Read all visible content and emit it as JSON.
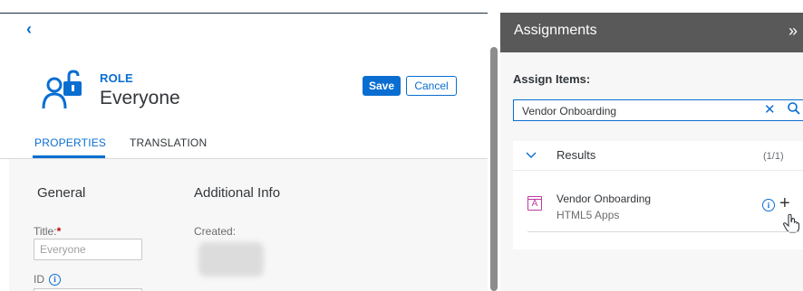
{
  "header": {
    "back_icon": "chevron-left-icon"
  },
  "role": {
    "type_label": "ROLE",
    "name": "Everyone",
    "icon": "user-unlocked-icon",
    "icon_color": "#0a6ed1"
  },
  "actions": {
    "save_label": "Save",
    "cancel_label": "Cancel",
    "accent": "#0a6ed1"
  },
  "tabs": [
    {
      "label": "PROPERTIES",
      "selected": true
    },
    {
      "label": "TRANSLATION",
      "selected": false
    }
  ],
  "general": {
    "title": "General",
    "title_field_label": "Title:",
    "required_mark": "*",
    "title_placeholder": "Everyone",
    "id_label": "ID",
    "id_info_icon": "info-icon"
  },
  "additional_info": {
    "title": "Additional Info",
    "created_label": "Created:"
  },
  "assignments": {
    "panel_title": "Assignments",
    "collapse_icon": "double-chevron-right-icon",
    "assign_items_label": "Assign Items:",
    "search_value": "Vendor Onboarding",
    "clear_icon": "clear-icon",
    "search_icon": "search-icon",
    "results": {
      "title": "Results",
      "count": "(1/1)",
      "items": [
        {
          "title": "Vendor Onboarding",
          "subtitle": "HTML5 Apps",
          "icon_letter": "A",
          "icon_color": "#c0399f"
        }
      ]
    }
  }
}
